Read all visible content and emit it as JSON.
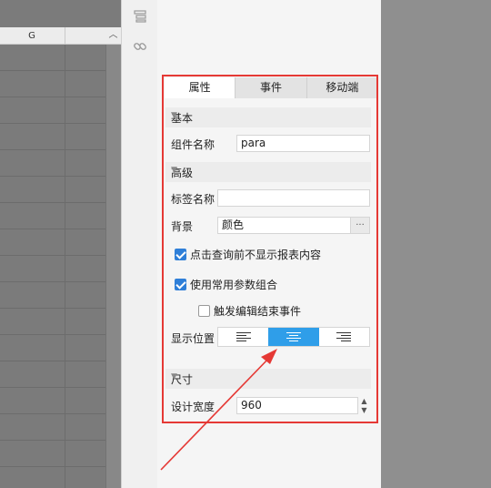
{
  "sheet": {
    "column_header": "G"
  },
  "tabs": [
    {
      "label": "属性",
      "active": true
    },
    {
      "label": "事件",
      "active": false
    },
    {
      "label": "移动端",
      "active": false
    }
  ],
  "sections": {
    "basic": "基本",
    "advanced": "高级",
    "size": "尺寸"
  },
  "fields": {
    "widget_name_label": "组件名称",
    "widget_name_value": "para",
    "tag_name_label": "标签名称",
    "tag_name_value": "",
    "background_label": "背景",
    "background_value": "颜色",
    "more_button": "···",
    "display_position_label": "显示位置",
    "design_width_label": "设计宽度",
    "design_width_value": "960"
  },
  "checkboxes": [
    {
      "label": "点击查询前不显示报表内容",
      "checked": true
    },
    {
      "label": "使用常用参数组合",
      "checked": true
    },
    {
      "label": "触发编辑结束事件",
      "checked": false
    }
  ],
  "alignment": {
    "options": [
      "left",
      "center",
      "right"
    ],
    "selected": "center"
  },
  "colors": {
    "accent": "#2f9ee9",
    "highlight_frame": "#e53935",
    "checkbox": "#2f7fd8"
  }
}
